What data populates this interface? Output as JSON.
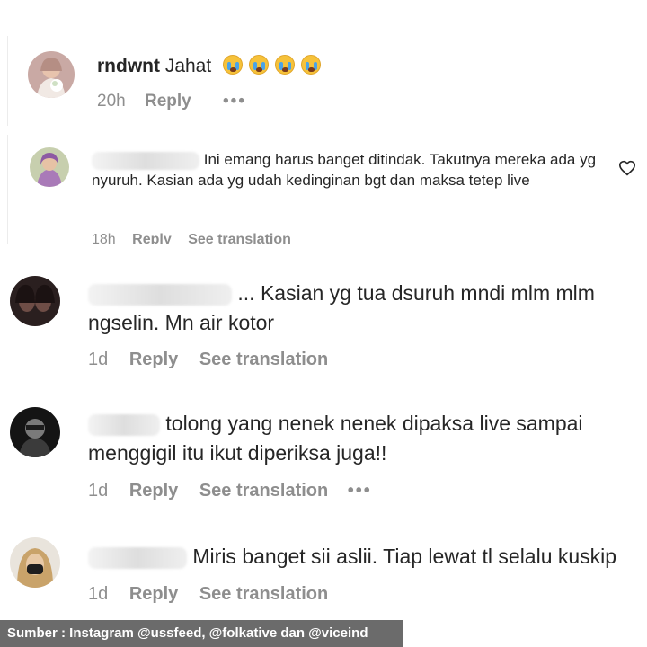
{
  "comments": [
    {
      "username": "rndwnt",
      "text": "Jahat",
      "emoji_icon": "loudly-crying-face-icon",
      "emoji_count": 4,
      "time": "20h",
      "reply_label": "Reply",
      "more_label": "•••"
    },
    {
      "text": "Ini emang harus banget ditindak. Takutnya mereka ada yg nyuruh. Kasian ada yg udah kedinginan bgt dan maksa tetep live",
      "time": "18h",
      "reply_label": "Reply",
      "translation_label": "See translation",
      "like_icon": "heart-icon"
    },
    {
      "text": "... Kasian yg tua dsuruh mndi mlm mlm ngselin. Mn air kotor",
      "time": "1d",
      "reply_label": "Reply",
      "translation_label": "See translation"
    },
    {
      "text": "tolong yang nenek nenek dipaksa live sampai menggigil itu ikut diperiksa juga!!",
      "time": "1d",
      "reply_label": "Reply",
      "translation_label": "See translation",
      "more_label": "•••"
    },
    {
      "text": "Miris banget sii aslii. Tiap lewat tl selalu kuskip",
      "time": "1d",
      "reply_label": "Reply",
      "translation_label": "See translation"
    }
  ],
  "source_caption": "Sumber : Instagram @ussfeed, @folkative dan @viceind",
  "colors": {
    "text": "#262626",
    "meta": "#8e8e8e",
    "caption_bg": "#6b6b6b",
    "caption_text": "#ffffff"
  }
}
